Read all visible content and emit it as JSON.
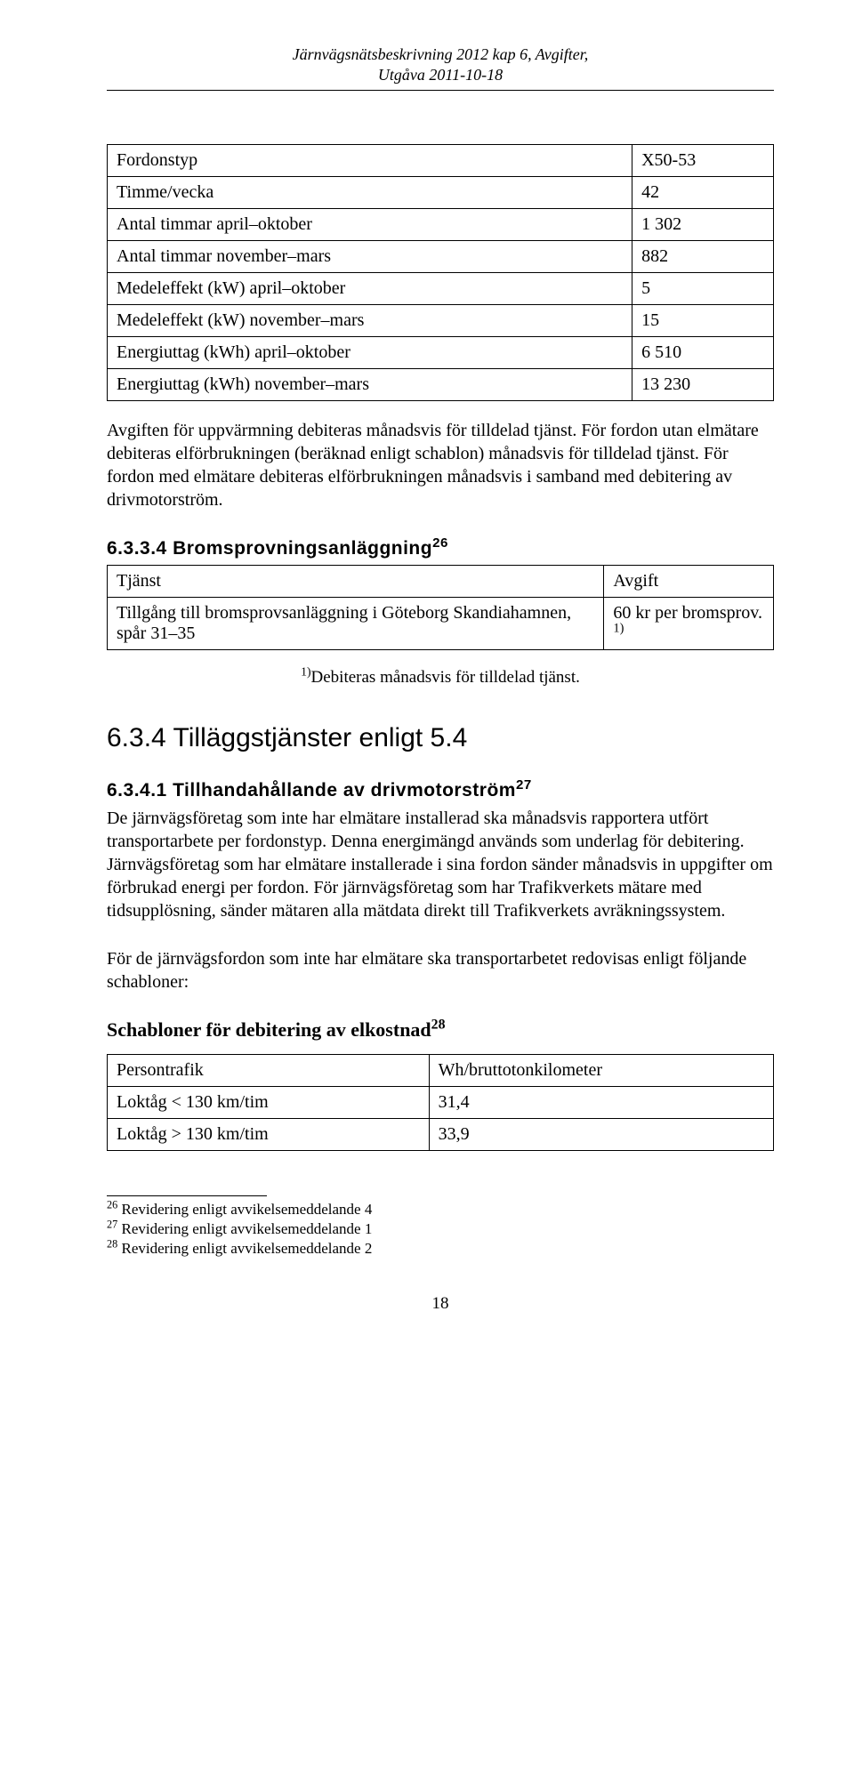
{
  "header": {
    "line1": "Järnvägsnätsbeskrivning 2012 kap 6, Avgifter,",
    "line2": "Utgåva 2011-10-18"
  },
  "table1": {
    "rows": [
      [
        "Fordonstyp",
        "X50-53"
      ],
      [
        "Timme/vecka",
        "42"
      ],
      [
        "Antal timmar april–oktober",
        "1 302"
      ],
      [
        "Antal timmar november–mars",
        "882"
      ],
      [
        "Medeleffekt (kW) april–oktober",
        "5"
      ],
      [
        "Medeleffekt (kW) november–mars",
        "15"
      ],
      [
        "Energiuttag (kWh) april–oktober",
        "6 510"
      ],
      [
        "Energiuttag (kWh) november–mars",
        "13 230"
      ]
    ]
  },
  "para1": "Avgiften för uppvärmning debiteras månadsvis för tilldelad tjänst. För fordon utan elmätare debiteras elförbrukningen (beräknad enligt schablon) månadsvis för tilldelad tjänst. För fordon med elmätare debiteras elförbrukningen månadsvis i samband med debitering av drivmotorström.",
  "sec6334": {
    "number": "6.3.3.4",
    "title": "Bromsprovningsanläggning",
    "fn": "26"
  },
  "table2": {
    "head": [
      "Tjänst",
      "Avgift"
    ],
    "row": [
      "Tillgång till bromsprovsanläggning i Göteborg Skandiahamnen, spår 31–35",
      "60 kr per bromsprov. ",
      "1)"
    ]
  },
  "note1": {
    "sup": "1)",
    "text": "Debiteras månadsvis för tilldelad tjänst."
  },
  "sec634": {
    "number": "6.3.4",
    "title": "Tilläggstjänster enligt 5.4"
  },
  "sec6341": {
    "number": "6.3.4.1",
    "title": "Tillhandahållande av drivmotorström",
    "fn": "27"
  },
  "para2": "De järnvägsföretag som inte har elmätare installerad ska månadsvis rapportera utfört transportarbete per fordonstyp. Denna energimängd används som underlag för debitering. Järnvägsföretag som har elmätare installerade i sina fordon sänder månadsvis in uppgifter om förbrukad energi per fordon. För järnvägsföretag som har Trafikverkets mätare med tidsupplösning, sänder mätaren alla mätdata direkt till Trafikverkets avräkningssystem.",
  "para3": " För de järnvägsfordon som inte har elmätare ska transportarbetet redovisas enligt följande schabloner:",
  "schablon": {
    "title": "Schabloner för debitering av elkostnad",
    "fn": "28"
  },
  "table3": {
    "head": [
      "Persontrafik",
      "Wh/bruttotonkilometer"
    ],
    "rows": [
      [
        "Loktåg < 130 km/tim",
        "31,4"
      ],
      [
        "Loktåg > 130 km/tim",
        "33,9"
      ]
    ]
  },
  "footnotes": [
    {
      "num": "26",
      "text": " Revidering enligt avvikelsemeddelande 4"
    },
    {
      "num": "27",
      "text": " Revidering enligt avvikelsemeddelande 1"
    },
    {
      "num": "28",
      "text": " Revidering enligt avvikelsemeddelande 2"
    }
  ],
  "pageNumber": "18"
}
